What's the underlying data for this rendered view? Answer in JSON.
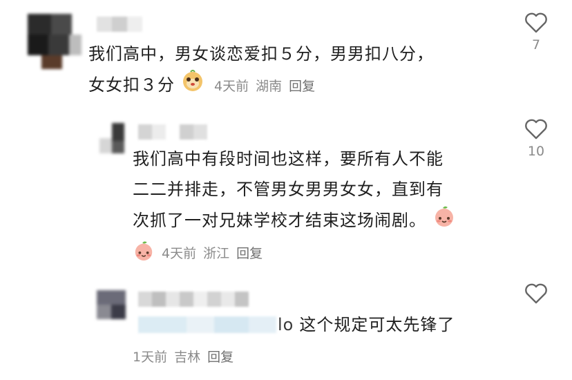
{
  "comments": [
    {
      "text_line1": "我们高中，男女谈恋爱扣５分，男男扣八分，",
      "text_line2": "女女扣３分",
      "emoji": "monkey-face-emoji",
      "time": "4天前",
      "location": "湖南",
      "reply": "回复",
      "likes": "7"
    },
    {
      "text_line1": "我们高中有段时间也这样，要所有人不能",
      "text_line2": "二二并排走，不管男女男男女女，直到有",
      "text_line3": "次抓了一对兄妹学校才结束这场闹剧。",
      "emoji": "peach-face-emoji",
      "time": "4天前",
      "location": "浙江",
      "reply": "回复",
      "likes": "10"
    },
    {
      "mention_tail": "lo",
      "text": "这个规定可太先锋了",
      "time": "1天前",
      "location": "吉林",
      "reply": "回复"
    }
  ],
  "colors": {
    "text": "#1f1f1f",
    "meta": "#8a8a8a",
    "heart": "#666666"
  }
}
